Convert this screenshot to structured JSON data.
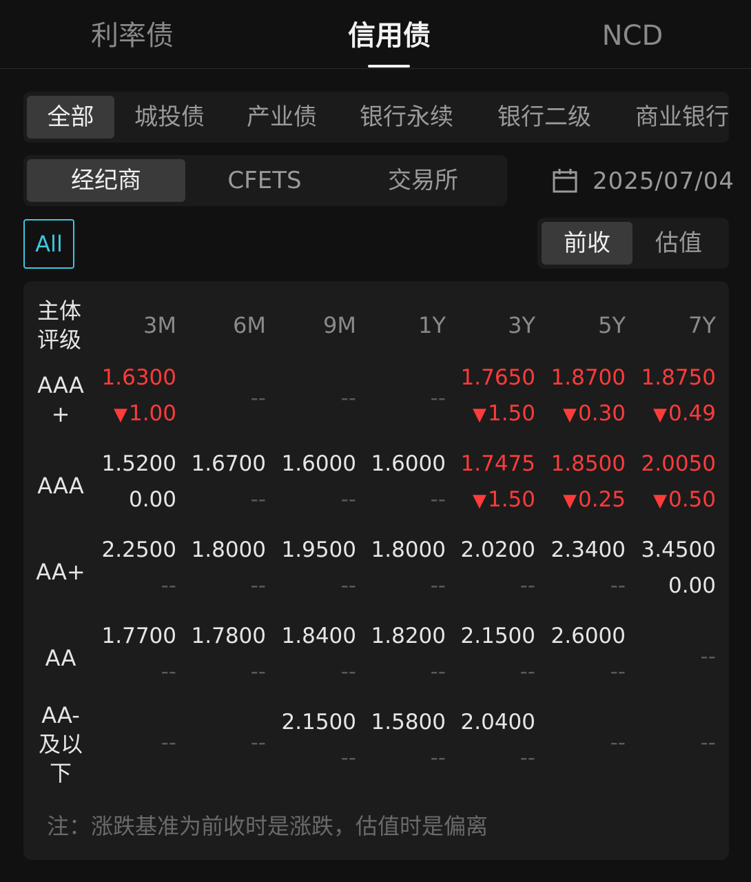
{
  "top_tabs": [
    "利率债",
    "信用债",
    "NCD"
  ],
  "categories": [
    "全部",
    "城投债",
    "产业债",
    "银行永续",
    "银行二级",
    "商业银行"
  ],
  "sources": [
    "经纪商",
    "CFETS",
    "交易所"
  ],
  "date": "2025/07/04",
  "all_label": "All",
  "toggle": [
    "前收",
    "估值"
  ],
  "table": {
    "rating_header_line1": "主体",
    "rating_header_line2": "评级",
    "columns": [
      "3M",
      "6M",
      "9M",
      "1Y",
      "3Y",
      "5Y",
      "7Y"
    ],
    "rows": [
      {
        "label_lines": [
          "AAA",
          "+"
        ],
        "cells": [
          {
            "value": "1.6300",
            "change": "1.00",
            "dir": "down",
            "red": true
          },
          {
            "value": "--"
          },
          {
            "value": "--"
          },
          {
            "value": "--"
          },
          {
            "value": "1.7650",
            "change": "1.50",
            "dir": "down",
            "red": true
          },
          {
            "value": "1.8700",
            "change": "0.30",
            "dir": "down",
            "red": true
          },
          {
            "value": "1.8750",
            "change": "0.49",
            "dir": "down",
            "red": true
          }
        ]
      },
      {
        "label_lines": [
          "AAA"
        ],
        "cells": [
          {
            "value": "1.5200",
            "change": "0.00"
          },
          {
            "value": "1.6700",
            "change": "--"
          },
          {
            "value": "1.6000",
            "change": "--"
          },
          {
            "value": "1.6000",
            "change": "--"
          },
          {
            "value": "1.7475",
            "change": "1.50",
            "dir": "down",
            "red": true
          },
          {
            "value": "1.8500",
            "change": "0.25",
            "dir": "down",
            "red": true
          },
          {
            "value": "2.0050",
            "change": "0.50",
            "dir": "down",
            "red": true
          }
        ]
      },
      {
        "label_lines": [
          "AA+"
        ],
        "cells": [
          {
            "value": "2.2500",
            "change": "--"
          },
          {
            "value": "1.8000",
            "change": "--"
          },
          {
            "value": "1.9500",
            "change": "--"
          },
          {
            "value": "1.8000",
            "change": "--"
          },
          {
            "value": "2.0200",
            "change": "--"
          },
          {
            "value": "2.3400",
            "change": "--"
          },
          {
            "value": "3.4500",
            "change": "0.00"
          }
        ]
      },
      {
        "label_lines": [
          "AA"
        ],
        "cells": [
          {
            "value": "1.7700",
            "change": "--"
          },
          {
            "value": "1.7800",
            "change": "--"
          },
          {
            "value": "1.8400",
            "change": "--"
          },
          {
            "value": "1.8200",
            "change": "--"
          },
          {
            "value": "2.1500",
            "change": "--"
          },
          {
            "value": "2.6000",
            "change": "--"
          },
          {
            "value": "--"
          }
        ]
      },
      {
        "label_lines": [
          "AA-",
          "及以",
          "下"
        ],
        "cells": [
          {
            "value": "--"
          },
          {
            "value": "--"
          },
          {
            "value": "2.1500",
            "change": "--"
          },
          {
            "value": "1.5800",
            "change": "--"
          },
          {
            "value": "2.0400",
            "change": "--"
          },
          {
            "value": "--"
          },
          {
            "value": "--"
          }
        ]
      }
    ],
    "note": "注：涨跌基准为前收时是涨跌，估值时是偏离"
  },
  "colors": {
    "background": "#111111",
    "panel": "#1c1c1c",
    "accent": "#3fc6e0",
    "down_red": "#ff3b3b"
  }
}
